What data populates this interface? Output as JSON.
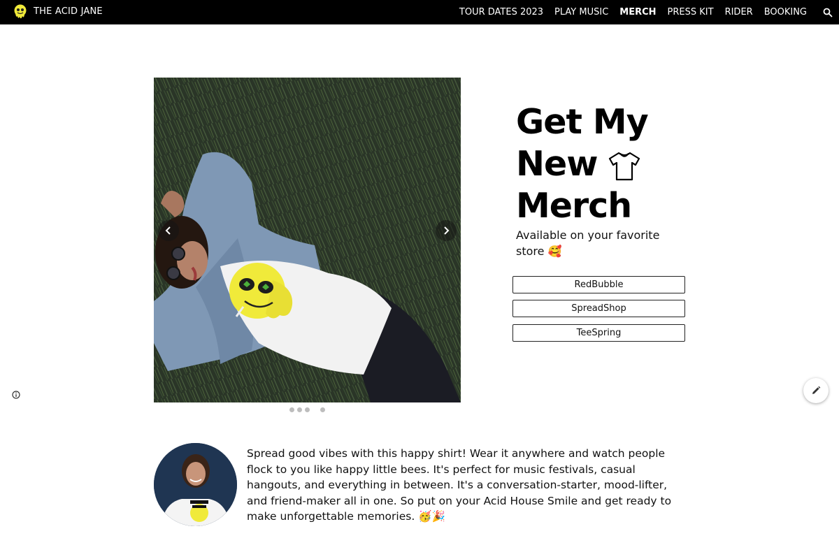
{
  "header": {
    "site_title": "THE ACID JANE",
    "logo_icon": "acid-smiley-logo",
    "nav": [
      {
        "label": "TOUR DATES 2023",
        "active": false
      },
      {
        "label": "PLAY MUSIC",
        "active": false
      },
      {
        "label": "MERCH",
        "active": true
      },
      {
        "label": "PRESS KIT",
        "active": false
      },
      {
        "label": "RIDER",
        "active": false
      },
      {
        "label": "BOOKING",
        "active": false
      }
    ],
    "search_icon": "search-icon"
  },
  "carousel": {
    "slide_count": 4,
    "active_slide": 4,
    "prev_icon": "chevron-left-icon",
    "next_icon": "chevron-right-icon"
  },
  "merch": {
    "headline_lines": [
      "Get My",
      "New",
      "Merch"
    ],
    "headline_icon": "t-shirt-icon",
    "subtitle": "Available on your favorite store 🥰",
    "stores": [
      {
        "label": "RedBubble"
      },
      {
        "label": "SpreadShop"
      },
      {
        "label": "TeeSpring"
      }
    ]
  },
  "footer_controls": {
    "info_icon": "info-icon",
    "edit_icon": "pencil-icon"
  },
  "description": {
    "text": "Spread good vibes with this happy shirt! Wear it anywhere and watch people flock to you like happy little bees. It's perfect for music festivals, casual hangouts, and everything in between. It's a conversation-starter, mood-lifter, and friend-maker all in one. So put on your Acid House Smile and get ready to make unforgettable memories. 🥳🎉"
  },
  "colors": {
    "topbar": "#000000",
    "accent_yellow": "#f0ea3a",
    "background": "#ffffff"
  }
}
